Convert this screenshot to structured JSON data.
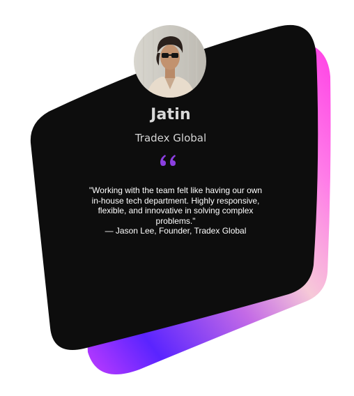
{
  "testimonial": {
    "name": "Jatin",
    "company": "Tradex Global",
    "quote": "\"Working with the team felt like having our own in-house tech department. Highly responsive, flexible, and innovative in solving complex problems.\"",
    "attribution": "— Jason Lee, Founder, Tradex Global"
  },
  "colors": {
    "card_background": "#0d0d0d",
    "quote_icon": "#8b3fe0",
    "gradient_stops": [
      "#ff4fe8",
      "#f7c6d9",
      "#6a2bff",
      "#c43cff"
    ]
  },
  "icons": {
    "quote": "opening-quote-icon",
    "avatar": "profile-photo"
  }
}
